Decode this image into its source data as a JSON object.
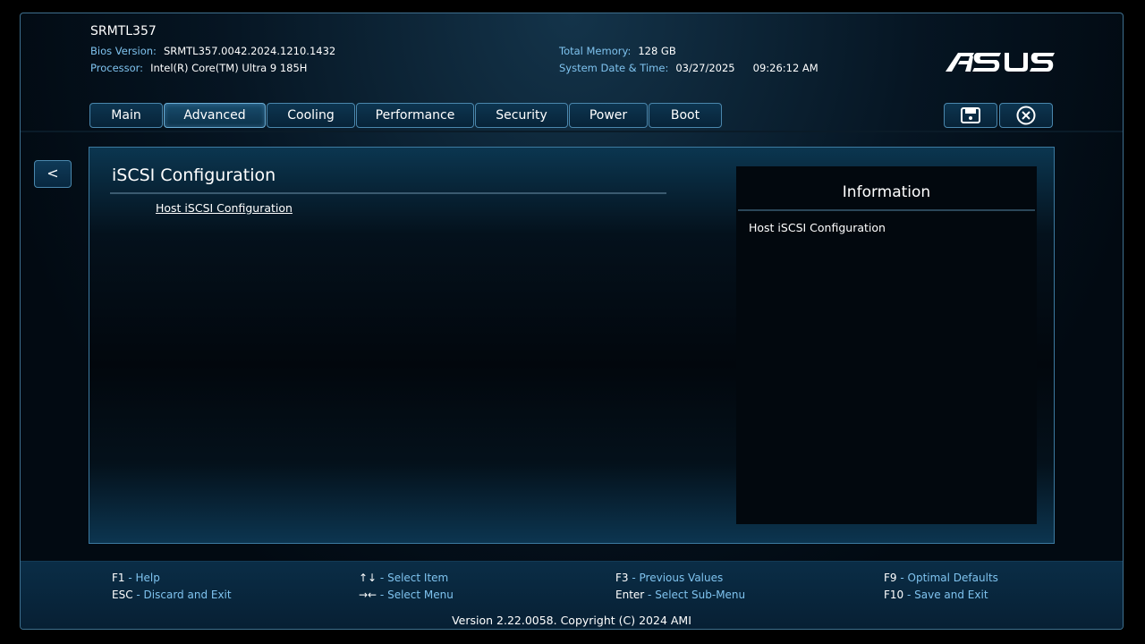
{
  "header": {
    "model": "SRMTL357",
    "bios_version_label": "Bios Version:",
    "bios_version_value": "SRMTL357.0042.2024.1210.1432",
    "processor_label": "Processor:",
    "processor_value": "Intel(R) Core(TM) Ultra 9 185H",
    "memory_label": "Total Memory:",
    "memory_value": "128 GB",
    "datetime_label": "System Date & Time:",
    "date_value": "03/27/2025",
    "time_value": "09:26:12 AM",
    "logo_text": "ASUS"
  },
  "tabs": [
    {
      "label": "Main",
      "active": false
    },
    {
      "label": "Advanced",
      "active": true
    },
    {
      "label": "Cooling",
      "active": false
    },
    {
      "label": "Performance",
      "active": false
    },
    {
      "label": "Security",
      "active": false
    },
    {
      "label": "Power",
      "active": false
    },
    {
      "label": "Boot",
      "active": false
    }
  ],
  "toolbar": {
    "save_icon": "save-icon",
    "exit_icon": "close-circle-icon"
  },
  "nav": {
    "back_label": "<"
  },
  "page": {
    "title": "iSCSI Configuration",
    "items": [
      "Host iSCSI Configuration"
    ]
  },
  "info": {
    "title": "Information",
    "text": "Host iSCSI Configuration"
  },
  "footer": {
    "keys": [
      {
        "key": "F1",
        "desc": "Help"
      },
      {
        "key": "ESC",
        "desc": "Discard and Exit"
      },
      {
        "key": "↑↓",
        "desc": "Select Item"
      },
      {
        "key": "→←",
        "desc": "Select Menu"
      },
      {
        "key": "F3",
        "desc": "Previous Values"
      },
      {
        "key": "Enter",
        "desc": "Select Sub-Menu"
      },
      {
        "key": "F9",
        "desc": "Optimal Defaults"
      },
      {
        "key": "F10",
        "desc": "Save and Exit"
      }
    ],
    "version": "Version 2.22.0058. Copyright (C) 2024 AMI"
  },
  "colors": {
    "accent_text": "#7fc3ef",
    "border": "#4a87ad",
    "background": "#020a12"
  }
}
